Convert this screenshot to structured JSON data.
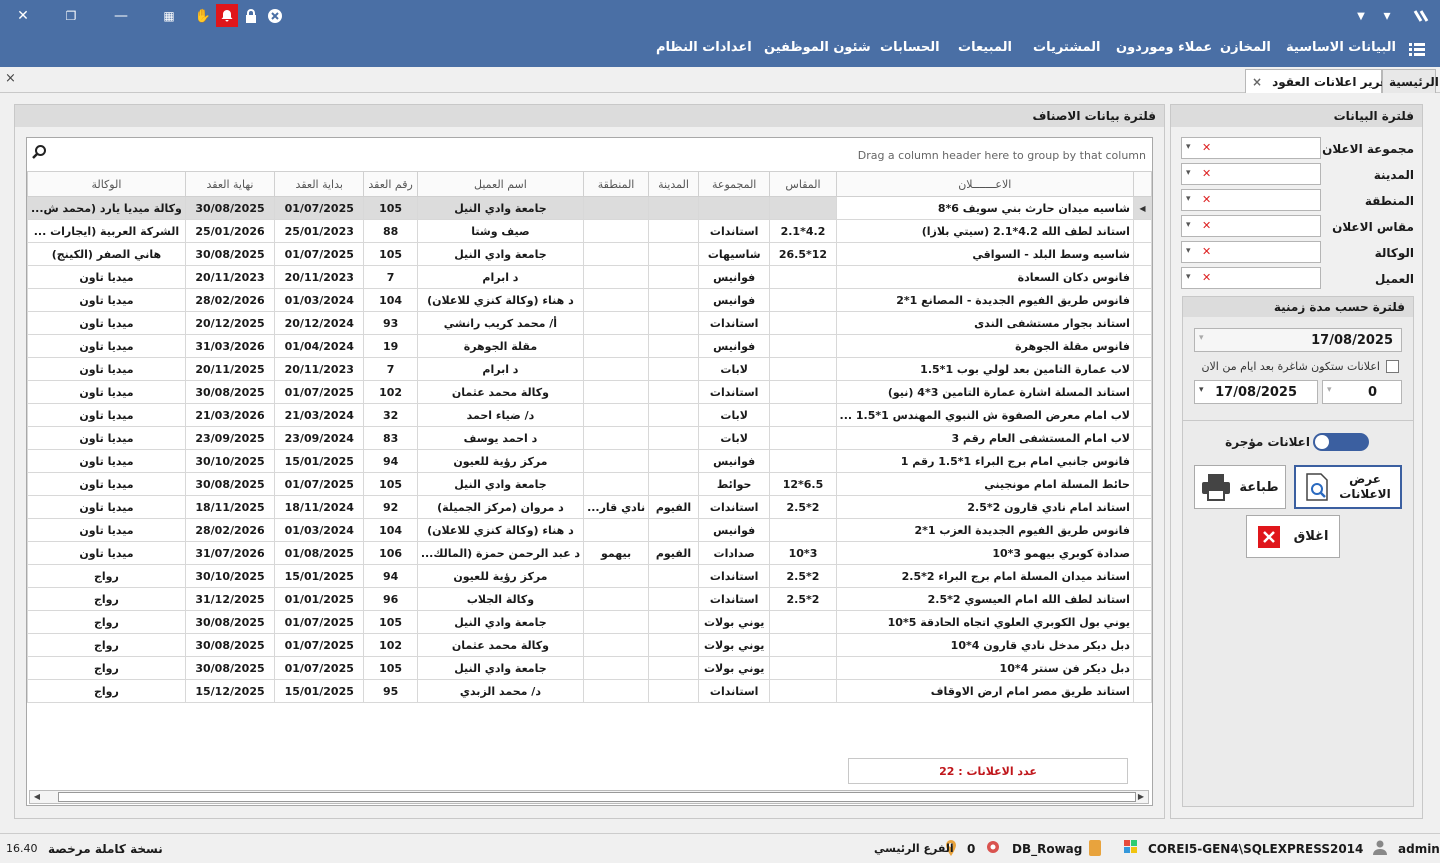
{
  "window": {
    "close_glyph": "✕",
    "restore_glyph": "❐",
    "minimize_glyph": "—"
  },
  "menu": [
    "البيانات الاساسية",
    "المخازن",
    "عملاء وموردون",
    "المشتريات",
    "المبيعات",
    "الحسابات",
    "شئون الموظفين",
    "اعدادات النظام"
  ],
  "tabs": {
    "home": "الرئيسية",
    "active": "تقرير اعلانات العقود",
    "close_glyph": "×"
  },
  "grid_panel": {
    "title": "فلترة بيانات الاصناف",
    "group_hint": "Drag a column header here to group by that column",
    "columns": [
      "الوكالة",
      "نهاية العقد",
      "بداية العقد",
      "رقم العقد",
      "اسم العميل",
      "المنطقة",
      "المدينة",
      "المجموعة",
      "المقاس",
      "الاعـــــــلان"
    ],
    "rows": [
      [
        "وكالة ميديا يارد (محمد ش...",
        "30/08/2025",
        "01/07/2025",
        "105",
        "جامعة وادي النيل",
        "",
        "",
        "",
        "",
        "شاسيه ميدان حارث بني سويف 6*8"
      ],
      [
        "الشركة العربية (ايجارات ...",
        "25/01/2026",
        "25/01/2023",
        "88",
        "صيف وشتا",
        "",
        "",
        "استاندات",
        "4.2*2.1",
        "استاند لطف الله 4.2*2.1 (سيتي بلازا)"
      ],
      [
        "هاني الصفر (الكينج)",
        "30/08/2025",
        "01/07/2025",
        "105",
        "جامعة وادي النيل",
        "",
        "",
        "شاسيهات",
        "12*26.5",
        "شاسيه وسط البلد - السواقي"
      ],
      [
        "ميديا تاون",
        "20/11/2023",
        "20/11/2023",
        "7",
        "د ابرام",
        "",
        "",
        "فوانيس",
        "",
        "فانوس دكان السعادة"
      ],
      [
        "ميديا تاون",
        "28/02/2026",
        "01/03/2024",
        "104",
        "د هناء (وكالة كنزي للاعلان)",
        "",
        "",
        "فوانيس",
        "",
        "فانوس طريق الفيوم الجديدة - المصانع 1*2"
      ],
      [
        "ميديا تاون",
        "20/12/2025",
        "20/12/2024",
        "93",
        "أ/ محمد كريب رانشي",
        "",
        "",
        "استاندات",
        "",
        "استاند بجوار مستشفى الندى"
      ],
      [
        "ميديا تاون",
        "31/03/2026",
        "01/04/2024",
        "19",
        "مقلة الجوهرة",
        "",
        "",
        "فوانيس",
        "",
        "فانوس مقلة الجوهرة"
      ],
      [
        "ميديا تاون",
        "20/11/2025",
        "20/11/2023",
        "7",
        "د ابرام",
        "",
        "",
        "لابات",
        "",
        "لاب عمارة التامين بعد لولي بوب 1*1.5"
      ],
      [
        "ميديا تاون",
        "30/08/2025",
        "01/07/2025",
        "102",
        "وكالة محمد عثمان",
        "",
        "",
        "استاندات",
        "",
        "استاند المسلة اشارة عمارة التامين 3*4 (نيو)"
      ],
      [
        "ميديا تاون",
        "21/03/2026",
        "21/03/2024",
        "32",
        "د/ ضياء احمد",
        "",
        "",
        "لابات",
        "",
        "لاب امام معرض الصفوة ش النبوي المهندس 1*1.5 ..."
      ],
      [
        "ميديا تاون",
        "23/09/2025",
        "23/09/2024",
        "83",
        "د احمد يوسف",
        "",
        "",
        "لابات",
        "",
        "لاب امام المستشفى العام رقم 3"
      ],
      [
        "ميديا تاون",
        "30/10/2025",
        "15/01/2025",
        "94",
        "مركز رؤية للعيون",
        "",
        "",
        "فوانيس",
        "",
        "فانوس جانبي امام برج البراء 1*1.5 رقم 1"
      ],
      [
        "ميديا تاون",
        "30/08/2025",
        "01/07/2025",
        "105",
        "جامعة وادي النيل",
        "",
        "",
        "حوائط",
        "6.5*12",
        "حائط المسلة امام مونجيني"
      ],
      [
        "ميديا تاون",
        "18/11/2025",
        "18/11/2024",
        "92",
        "د مروان (مركز الجميلة)",
        "نادي قار...",
        "الفيوم",
        "استاندات",
        "2*2.5",
        "استاند امام نادي قارون 2*2.5"
      ],
      [
        "ميديا تاون",
        "28/02/2026",
        "01/03/2024",
        "104",
        "د هناء (وكالة كنزي للاعلان)",
        "",
        "",
        "فوانيس",
        "",
        "فانوس طريق الفيوم الجديدة العزب 1*2"
      ],
      [
        "ميديا تاون",
        "31/07/2026",
        "01/08/2025",
        "106",
        "د عبد الرحمن حمزة (المالك...",
        "بيهمو",
        "الفيوم",
        "صدادات",
        "3*10",
        "صدادة كوبري بيهمو 3*10"
      ],
      [
        "رواج",
        "30/10/2025",
        "15/01/2025",
        "94",
        "مركز رؤية للعيون",
        "",
        "",
        "استاندات",
        "2*2.5",
        "استاند ميدان المسلة امام برج البراء 2*2.5"
      ],
      [
        "رواج",
        "31/12/2025",
        "01/01/2025",
        "96",
        "وكالة الجلاب",
        "",
        "",
        "استاندات",
        "2*2.5",
        "استاند لطف الله امام العيسوي 2*2.5"
      ],
      [
        "رواج",
        "30/08/2025",
        "01/07/2025",
        "105",
        "جامعة وادي النيل",
        "",
        "",
        "يوني بولات",
        "",
        "يوني بول الكوبري العلوي اتجاه الحادقة 5*10"
      ],
      [
        "رواج",
        "30/08/2025",
        "01/07/2025",
        "102",
        "وكالة محمد عثمان",
        "",
        "",
        "يوني بولات",
        "",
        "دبل ديكر مدخل نادي قارون 4*10"
      ],
      [
        "رواج",
        "30/08/2025",
        "01/07/2025",
        "105",
        "جامعة وادي النيل",
        "",
        "",
        "يوني بولات",
        "",
        "دبل ديكر فن سنتر 4*10"
      ],
      [
        "رواج",
        "15/12/2025",
        "15/01/2025",
        "95",
        "د/ محمد الزبدي",
        "",
        "",
        "استاندات",
        "",
        "استاند طريق مصر امام ارض الاوقاف"
      ]
    ],
    "count_label": "عدد الاعلانات : 22"
  },
  "filter_panel": {
    "title": "فلترة البيانات",
    "fields": [
      "مجموعة الاعلان",
      "المدينة",
      "المنطقة",
      "مقاس الاعلان",
      "الوكالة",
      "العميل"
    ],
    "period_title": "فلترة حسب مدة زمنية",
    "date_from": "17/08/2025",
    "checkbox_label": "اعلانات ستكون شاغرة بعد ايام من الان",
    "days": "0",
    "date_to": "17/08/2025",
    "toggle_label": "اعلانات مؤجرة",
    "view_button": "عرض الاعلانات",
    "print_button": "طباعة",
    "close_button": "اغلاق"
  },
  "status": {
    "user": "admin",
    "server": "COREI5-GEN4\\SQLEXPRESS2014",
    "db": "DB_Rowag",
    "count": "0",
    "branch": "الفرع الرئيسي",
    "license": "نسخة كاملة مرخصة",
    "version": "16.40"
  },
  "colors": {
    "header_bg": "#4a6fa5",
    "alert": "#e0161b",
    "count_text": "#c0161b",
    "toggle": "#3b5fa0"
  }
}
